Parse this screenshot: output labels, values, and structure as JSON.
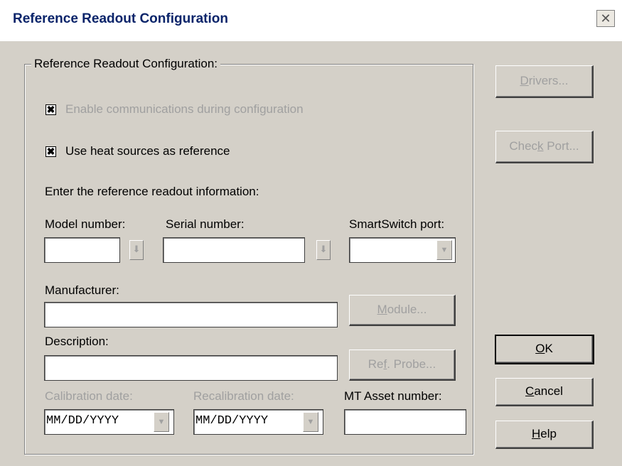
{
  "window": {
    "title": "Reference Readout Configuration",
    "close_glyph": "✕"
  },
  "group": {
    "label": "Reference Readout Configuration:"
  },
  "checkboxes": {
    "enable_comm": {
      "label": "Enable communications during configuration",
      "checked": true,
      "enabled": false
    },
    "use_heat": {
      "label": "Use heat sources as reference",
      "checked": true,
      "enabled": true
    }
  },
  "labels": {
    "enter_info": "Enter the reference readout information:",
    "model": "Model number:",
    "serial": "Serial number:",
    "smartswitch": "SmartSwitch port:",
    "manufacturer": "Manufacturer:",
    "description": "Description:",
    "cal_date": "Calibration date:",
    "recal_date": "Recalibration date:",
    "mt_asset": "MT Asset number:"
  },
  "fields": {
    "model_value": "",
    "serial_value": "",
    "smartswitch_value": "",
    "manufacturer_value": "",
    "description_value": "",
    "cal_date_value": "MM/DD/YYYY",
    "recal_date_value": "MM/DD/YYYY",
    "mt_asset_value": ""
  },
  "buttons": {
    "drivers": {
      "pre": "",
      "u": "D",
      "post": "rivers..."
    },
    "check_port": {
      "pre": "Chec",
      "u": "k",
      "post": " Port..."
    },
    "module": {
      "pre": "",
      "u": "M",
      "post": "odule..."
    },
    "ref_probe": {
      "pre": "Re",
      "u": "f",
      "post": ". Probe..."
    },
    "ok": {
      "pre": "",
      "u": "O",
      "post": "K"
    },
    "cancel": {
      "pre": "",
      "u": "C",
      "post": "ancel"
    },
    "help": {
      "pre": "",
      "u": "H",
      "post": "elp"
    }
  },
  "icons": {
    "check_mark": "✖",
    "lookup": "⬇",
    "dropdown": "▼"
  }
}
